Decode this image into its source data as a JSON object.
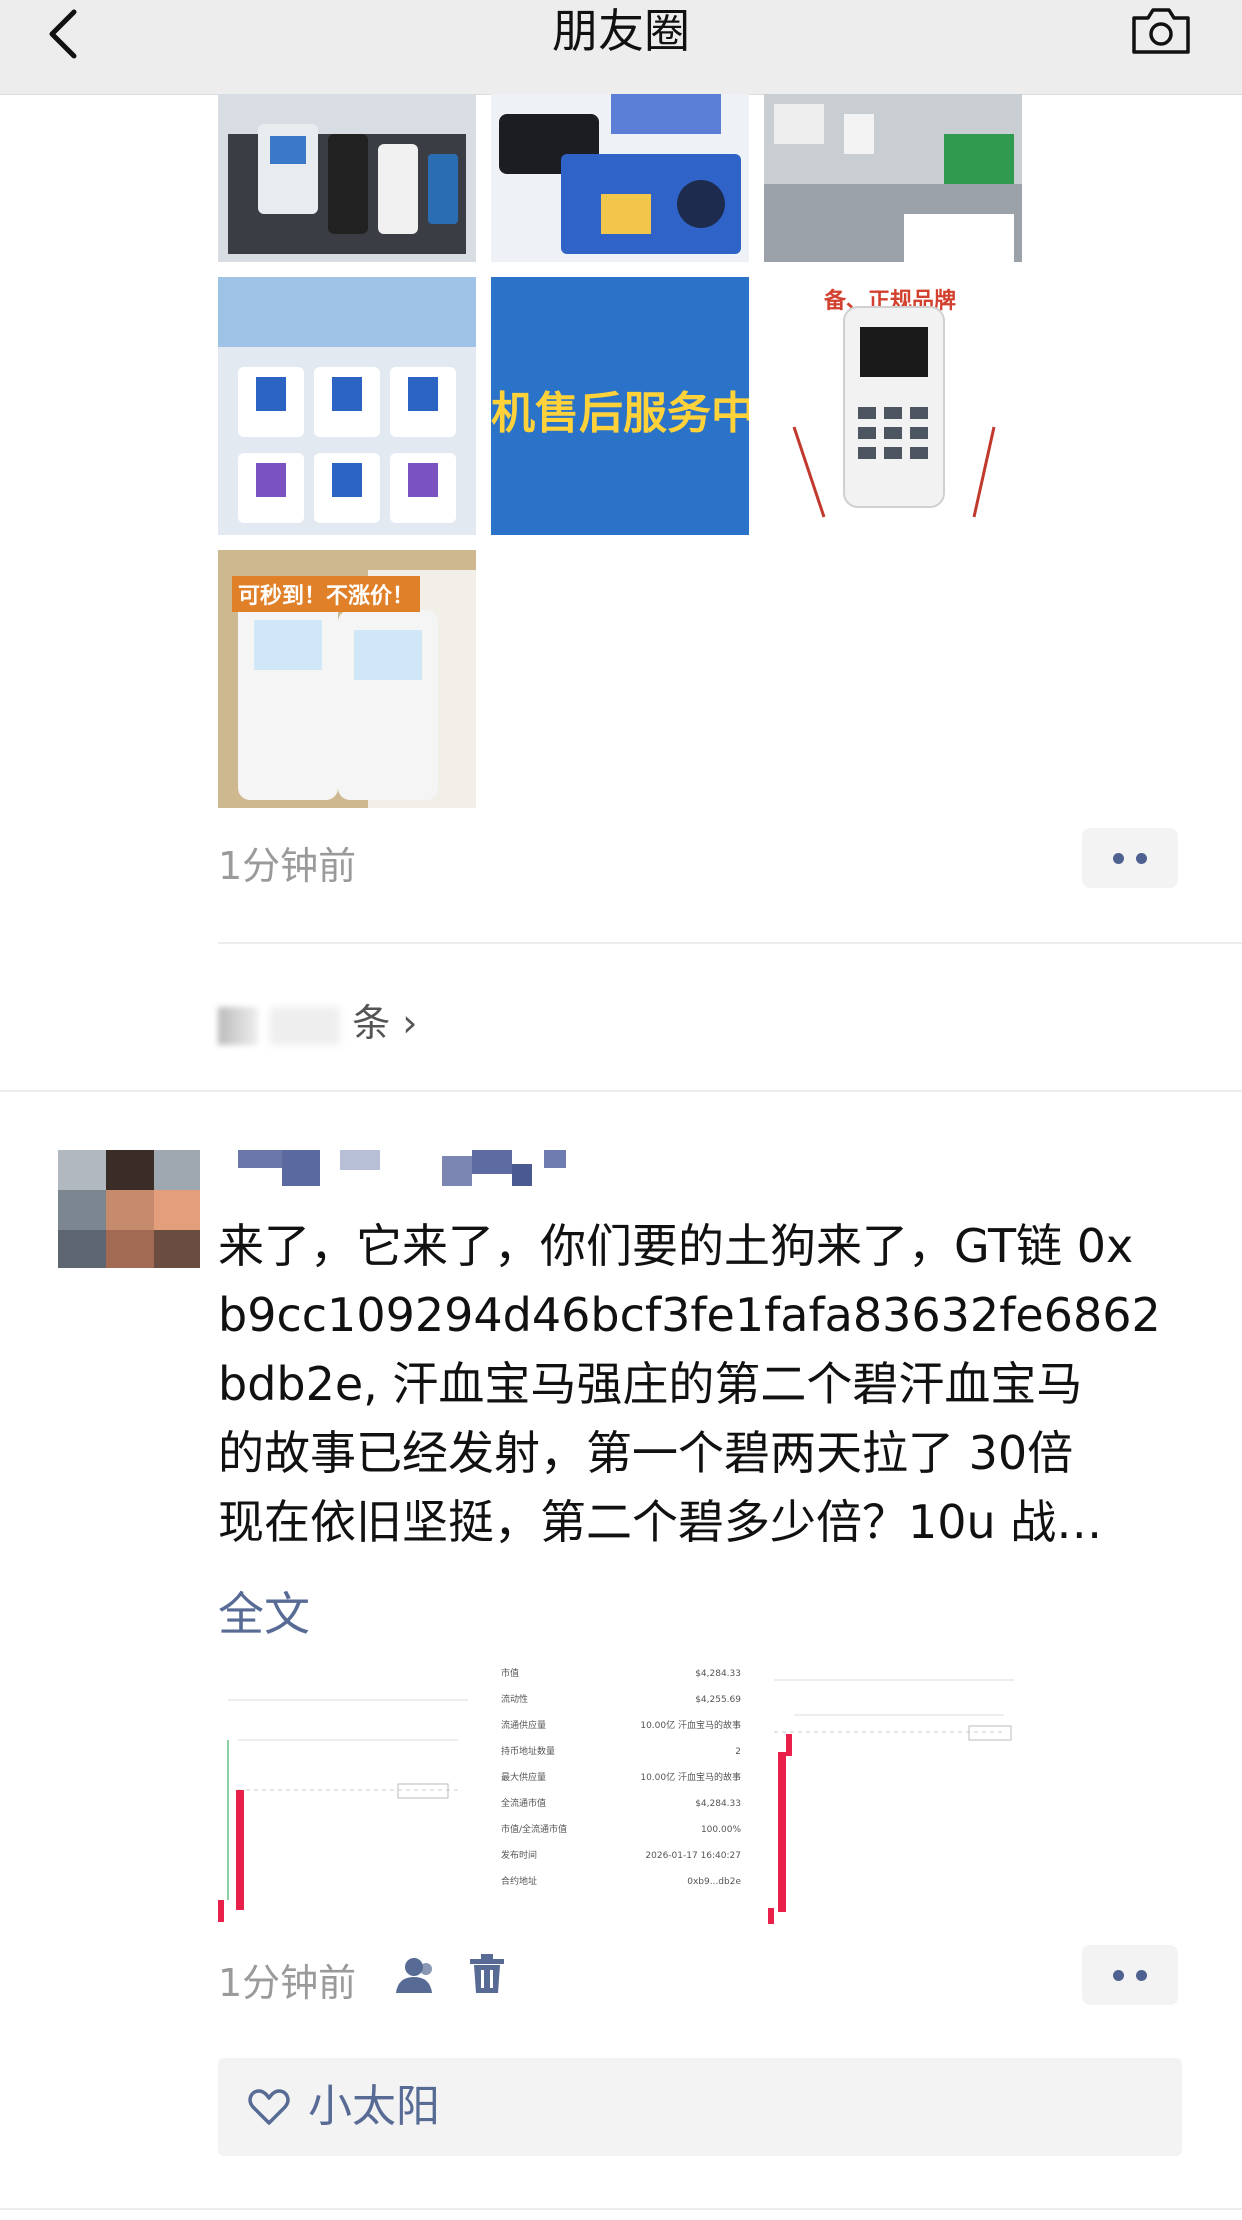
{
  "nav": {
    "title": "朋友圈"
  },
  "post1": {
    "time": "1分钟前",
    "image_captions": [
      "机售后服务中",
      "可秒到！不涨价！",
      "备、正规品牌"
    ]
  },
  "all_link": "条",
  "post2": {
    "text_lines": [
      "来了，它来了，你们要的土狗来了，GT链 0x",
      "b9cc109294d46bcf3fe1fafa83632fe6862",
      "bdb2e, 汗血宝马强庄的第二个碧汗血宝马",
      "的故事已经发射，第一个碧两天拉了 30倍",
      "现在依旧坚挺，第二个碧多少倍？10u 战…"
    ],
    "fulltext": "全文",
    "time": "1分钟前",
    "likes": [
      "小太阳"
    ],
    "screenshot_info": {
      "labels": [
        "市值",
        "流动性",
        "流通供应量",
        "持币地址数量",
        "最大供应量",
        "全流通市值",
        "市值/全流通市值",
        "发布时间",
        "合约地址"
      ],
      "values": [
        "$4,284.33",
        "$4,255.69",
        "10.00亿 汗血宝马的故事",
        "2",
        "10.00亿 汗血宝马的故事",
        "$4,284.33",
        "100.00%",
        "2026-01-17 16:40:27",
        "0xb9...db2e"
      ]
    }
  },
  "colors": {
    "link": "#576b95",
    "nav_bg": "#ededed",
    "candle_red": "#e8204a"
  }
}
